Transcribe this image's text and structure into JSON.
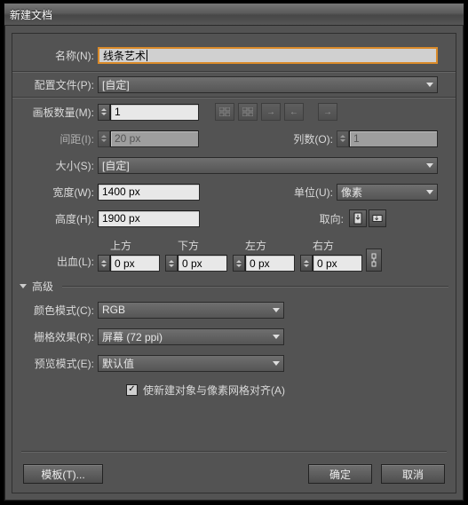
{
  "title": "新建文档",
  "labels": {
    "name": "名称(N):",
    "profile": "配置文件(P):",
    "artboards": "画板数量(M):",
    "spacing": "间距(I):",
    "columns": "列数(O):",
    "size": "大小(S):",
    "width": "宽度(W):",
    "units": "单位(U):",
    "height": "高度(H):",
    "orient": "取向:",
    "bleed": "出血(L):",
    "top": "上方",
    "bottom": "下方",
    "left": "左方",
    "right": "右方",
    "advanced": "高级",
    "colormode": "颜色模式(C):",
    "raster": "栅格效果(R):",
    "preview": "预览模式(E):",
    "aligncheck": "使新建对象与像素网格对齐(A)"
  },
  "values": {
    "name": "线条艺术",
    "profile": "[自定]",
    "artboards": "1",
    "spacing": "20 px",
    "columns": "1",
    "size": "[自定]",
    "width": "1400 px",
    "units": "像素",
    "height": "1900 px",
    "bleed_top": "0 px",
    "bleed_bottom": "0 px",
    "bleed_left": "0 px",
    "bleed_right": "0 px",
    "colormode": "RGB",
    "raster": "屏幕 (72 ppi)",
    "preview": "默认值"
  },
  "buttons": {
    "template": "模板(T)...",
    "ok": "确定",
    "cancel": "取消"
  }
}
